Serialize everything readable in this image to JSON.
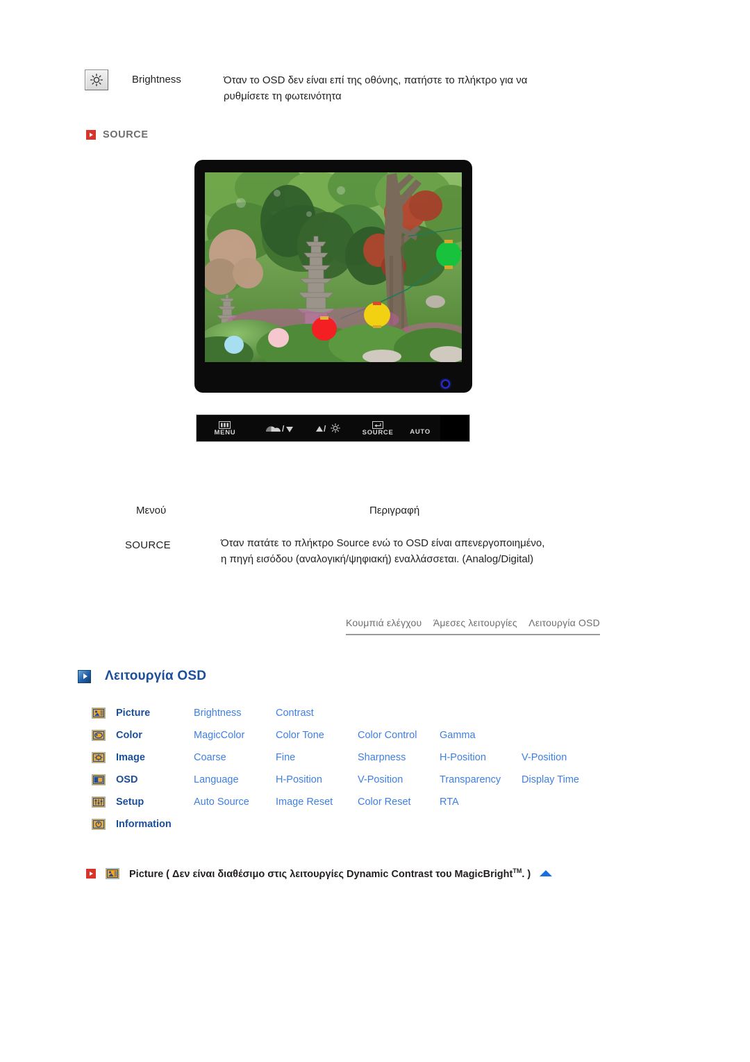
{
  "brightness_row": {
    "icon": "brightness-sun-icon",
    "label": "Brightness",
    "description": "Όταν το OSD δεν είναι επί της οθόνης, πατήστε το πλήκτρο για να ρυθμίσετε τη φωτεινότητα"
  },
  "source_section": {
    "bullet_icon": "red-triangle-bullet-icon",
    "title": "SOURCE"
  },
  "monitor": {
    "photo_alt": "Φωτογραφία οθόνης με κορεατικό κήπο, πέτρινες παγόδες και χρωματιστά φανάρια",
    "power_led": "power-led-indicator"
  },
  "control_bar": {
    "buttons": [
      {
        "label": "MENU",
        "glyph": "menu-bars-icon"
      },
      {
        "label": "",
        "glyph": "magicbright-down-icon"
      },
      {
        "label": "",
        "glyph": "up-brightness-icon"
      },
      {
        "label": "SOURCE",
        "glyph": "enter-return-icon"
      },
      {
        "label": "AUTO",
        "glyph": ""
      }
    ],
    "menu_label": "MENU",
    "source_label": "SOURCE",
    "auto_label": "AUTO"
  },
  "menu_table": {
    "headers": {
      "menu": "Μενού",
      "description": "Περιγραφή"
    },
    "rows": [
      {
        "menu": "SOURCE",
        "description": "Όταν πατάτε το πλήκτρο Source ενώ το OSD είναι απενεργοποιημένο, η πηγή εισόδου (αναλογική/ψηφιακή) εναλλάσσεται. (Analog/Digital)"
      }
    ]
  },
  "tabs": [
    {
      "label": "Κουμπιά ελέγχου"
    },
    {
      "label": "Άμεσες λειτουργίες"
    },
    {
      "label": "Λειτουργία OSD"
    }
  ],
  "osd_section": {
    "bullet_icon": "blue-triangle-bullet-icon",
    "title": "Λειτουργία OSD"
  },
  "osd_table": {
    "rows": [
      {
        "icon": "picture-icon",
        "category": "Picture",
        "items": [
          "Brightness",
          "Contrast"
        ]
      },
      {
        "icon": "color-icon",
        "category": "Color",
        "items": [
          "MagicColor",
          "Color Tone",
          "Color Control",
          "Gamma"
        ]
      },
      {
        "icon": "image-icon",
        "category": "Image",
        "items": [
          "Coarse",
          "Fine",
          "Sharpness",
          "H-Position",
          "V-Position"
        ]
      },
      {
        "icon": "osd-icon",
        "category": "OSD",
        "items": [
          "Language",
          "H-Position",
          "V-Position",
          "Transparency",
          "Display Time"
        ]
      },
      {
        "icon": "setup-icon",
        "category": "Setup",
        "items": [
          "Auto Source",
          "Image Reset",
          "Color Reset",
          "RTA"
        ]
      },
      {
        "icon": "information-icon",
        "category": "Information",
        "items": []
      }
    ]
  },
  "bottom_line": {
    "bullet_icon": "red-triangle-bullet-icon",
    "category_icon": "picture-icon",
    "text_before": "Picture ( Δεν είναι διαθέσιμο στις λειτουργίες Dynamic Contrast του MagicBright",
    "trademark": "TM",
    "text_after": ". )",
    "top_arrow_icon": "scroll-to-top-icon"
  },
  "colors": {
    "red_bullet": "#d9342b",
    "blue_heading": "#1b4f9c",
    "blue_link": "#3f7fe0",
    "icon_orange": "#f5a623",
    "grey_text": "#6d6e71"
  }
}
